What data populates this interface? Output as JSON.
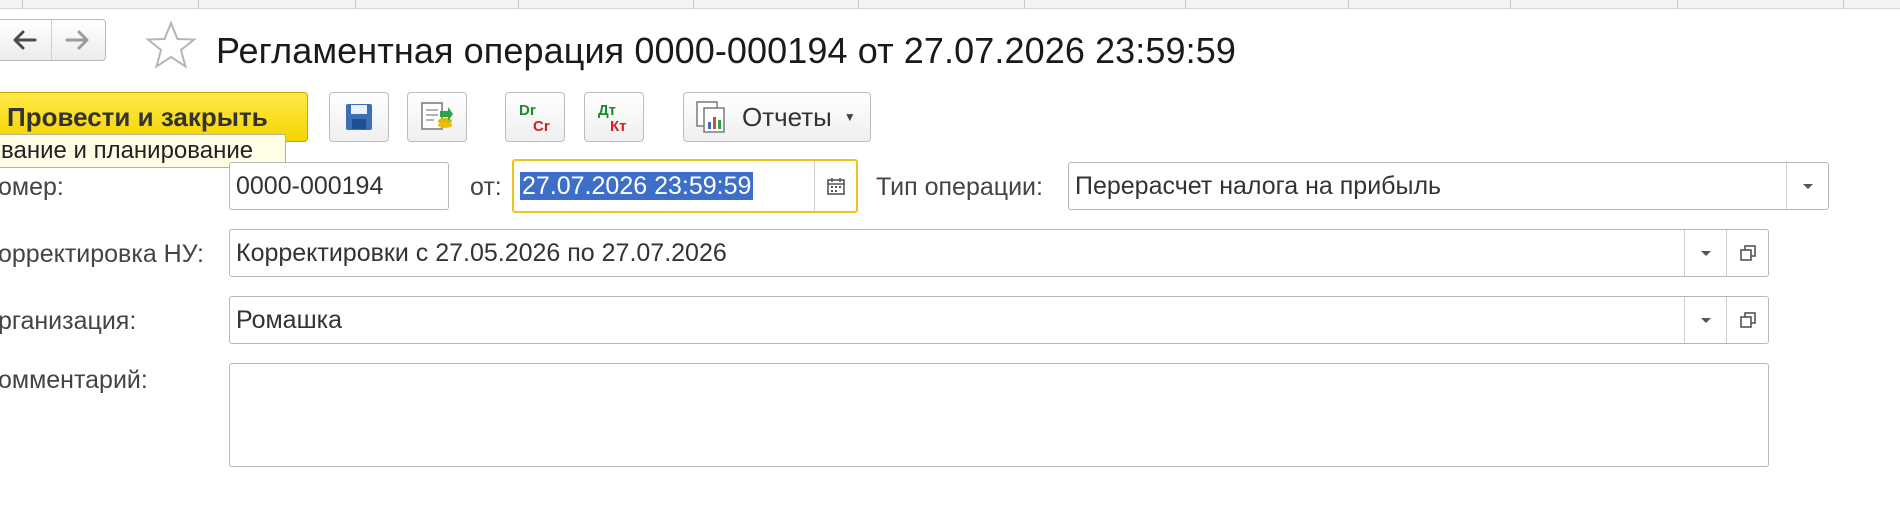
{
  "window": {
    "title": "Регламентная операция 0000-000194 от 27.07.2026 23:59:59"
  },
  "nav": {
    "back_icon": "arrow-left-icon",
    "forward_icon": "arrow-right-icon",
    "favorite_icon": "star-icon"
  },
  "toolbar": {
    "post_and_close_label": "Провести и закрыть",
    "save_icon": "save-icon",
    "post_icon": "post-icon",
    "dr_cr": {
      "top": "Dr",
      "bottom": "Cr"
    },
    "dt_kt": {
      "top": "Дт",
      "bottom": "Кт"
    },
    "reports_label": "Отчеты"
  },
  "tooltip": {
    "text": "вание и планирование"
  },
  "form": {
    "number_label": "омер:",
    "number_value": "0000-000194",
    "date_label": "от:",
    "date_value": "27.07.2026 23:59:59",
    "operation_type_label": "Тип операции:",
    "operation_type_value": "Перерасчет налога на прибыль",
    "nu_correction_label": "орректировка НУ:",
    "nu_correction_value": "Корректировки с 27.05.2026 по 27.07.2026",
    "organization_label": "рганизация:",
    "organization_value": "Ромашка",
    "comment_label": "омментарий:",
    "comment_value": ""
  },
  "colors": {
    "primary_button": "#f5d400",
    "selection": "#3d6fc8",
    "focus_border": "#f0c419",
    "dr_color": "#1a8a2e",
    "cr_color": "#d42020"
  }
}
